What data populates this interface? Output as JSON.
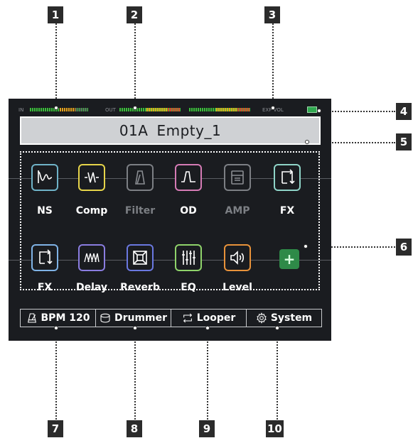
{
  "callouts": [
    "1",
    "2",
    "3",
    "4",
    "5",
    "6",
    "7",
    "8",
    "9",
    "10"
  ],
  "meters": {
    "in_label": "IN",
    "out_label": "OUT",
    "exp_vol_label": "EXP VOL"
  },
  "preset": {
    "number": "01A",
    "name": "Empty_1"
  },
  "chain_row_1": [
    {
      "label": "NS",
      "icon": "noise-gate-icon",
      "color": "#6fb3c8",
      "enabled": true
    },
    {
      "label": "Comp",
      "icon": "compressor-icon",
      "color": "#e6d44a",
      "enabled": true
    },
    {
      "label": "Filter",
      "icon": "filter-icon",
      "color": "#7c7f84",
      "enabled": false
    },
    {
      "label": "OD",
      "icon": "overdrive-icon",
      "color": "#d57bb5",
      "enabled": true
    },
    {
      "label": "AMP",
      "icon": "amp-icon",
      "color": "#7c7f84",
      "enabled": false
    },
    {
      "label": "FX",
      "icon": "fx-loop-icon",
      "color": "#8fd4c8",
      "enabled": true
    }
  ],
  "chain_row_2": [
    {
      "label": "FX",
      "icon": "fx-loop-icon",
      "color": "#7fb3e6",
      "enabled": true
    },
    {
      "label": "Delay",
      "icon": "delay-icon",
      "color": "#8a7de0",
      "enabled": true
    },
    {
      "label": "Reverb",
      "icon": "reverb-icon",
      "color": "#6a78e0",
      "enabled": true
    },
    {
      "label": "EQ",
      "icon": "eq-icon",
      "color": "#8fd36a",
      "enabled": true
    },
    {
      "label": "Level",
      "icon": "level-icon",
      "color": "#e8923a",
      "enabled": true
    }
  ],
  "add_block_label": "+",
  "bottom_tabs": [
    {
      "label": "BPM 120",
      "icon": "metronome-icon"
    },
    {
      "label": "Drummer",
      "icon": "drum-icon"
    },
    {
      "label": "Looper",
      "icon": "loop-icon"
    },
    {
      "label": "System",
      "icon": "gear-icon"
    }
  ]
}
